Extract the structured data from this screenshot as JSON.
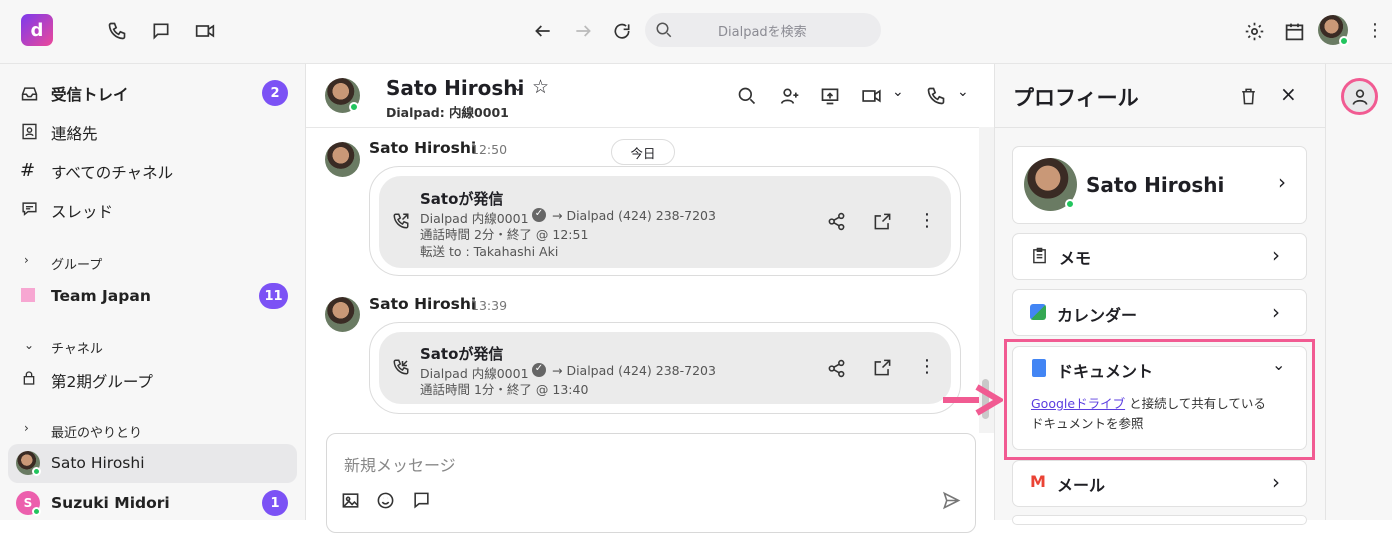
{
  "app": {
    "logo": "d",
    "search_placeholder": "Dialpadを検索"
  },
  "sidebar": {
    "inbox": "受信トレイ",
    "inbox_count": "2",
    "contacts": "連絡先",
    "channels": "すべてのチャネル",
    "threads": "スレッド",
    "groups_header": "グループ",
    "team": "Team Japan",
    "team_count": "11",
    "channel_header": "チャネル",
    "channel_item": "第2期グループ",
    "recent_header": "最近のやりとり",
    "recent1": "Sato Hiroshi",
    "recent2": "Suzuki Midori",
    "recent2_initial": "S",
    "recent2_count": "1"
  },
  "chat": {
    "name": "Sato Hiroshi",
    "subtitle": "Dialpad: 内線0001",
    "today": "今日",
    "messages": [
      {
        "name": "Sato Hiroshi",
        "time": "12:50",
        "title": "Satoが発信",
        "from": "Dialpad 内線0001",
        "to": "→ Dialpad (424) 238-7203",
        "duration": "通話時間 2分・終了 @ 12:51",
        "transfer": "転送 to : Takahashi Aki"
      },
      {
        "name": "Sato Hiroshi",
        "time": "13:39",
        "title": "Satoが発信",
        "from": "Dialpad 内線0001",
        "to": "→ Dialpad (424) 238-7203",
        "duration": "通話時間 1分・終了 @ 13:40"
      }
    ],
    "placeholder": "新規メッセージ"
  },
  "profile": {
    "title": "プロフィール",
    "name": "Sato Hiroshi",
    "memo": "メモ",
    "calendar": "カレンダー",
    "docs": "ドキュメント",
    "docs_link": "Googleドライブ",
    "docs_text1": " と接続して共有している",
    "docs_text2": "ドキュメントを参照",
    "mail": "メール"
  },
  "colors": {
    "accent": "#7c52f5",
    "highlight": "#f15b92"
  }
}
